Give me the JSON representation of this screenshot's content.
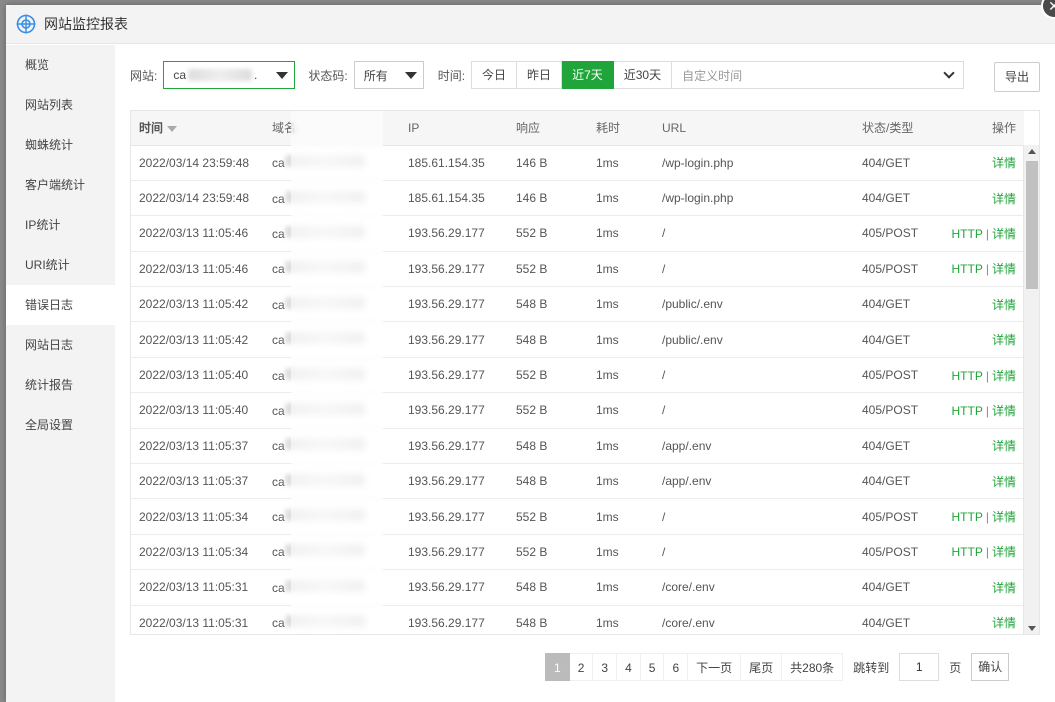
{
  "window": {
    "title": "网站监控报表",
    "close": "✕"
  },
  "sidebar": {
    "items": [
      {
        "label": "概览"
      },
      {
        "label": "网站列表"
      },
      {
        "label": "蜘蛛统计"
      },
      {
        "label": "客户端统计"
      },
      {
        "label": "IP统计"
      },
      {
        "label": "URI统计"
      },
      {
        "label": "错误日志"
      },
      {
        "label": "网站日志"
      },
      {
        "label": "统计报告"
      },
      {
        "label": "全局设置"
      }
    ],
    "active_index": 6
  },
  "filters": {
    "site_label": "网站:",
    "site_value": "ca",
    "site_suffix": ".",
    "status_label": "状态码:",
    "status_value": "所有",
    "time_label": "时间:",
    "ranges": [
      "今日",
      "昨日",
      "近7天",
      "近30天"
    ],
    "active_range": "近7天",
    "custom_placeholder": "自定义时间",
    "export_label": "导出"
  },
  "table": {
    "columns": [
      "时间",
      "域名",
      "IP",
      "响应",
      "耗时",
      "URL",
      "状态/类型",
      "操作"
    ],
    "domain_prefix": "ca",
    "http_label": "HTTP",
    "detail_label": "详情",
    "rows": [
      {
        "time": "2022/03/14 23:59:48",
        "ip": "185.61.154.35",
        "resp": "146 B",
        "cost": "1ms",
        "url": "/wp-login.php",
        "status": "404/GET",
        "http": false
      },
      {
        "time": "2022/03/14 23:59:48",
        "ip": "185.61.154.35",
        "resp": "146 B",
        "cost": "1ms",
        "url": "/wp-login.php",
        "status": "404/GET",
        "http": false
      },
      {
        "time": "2022/03/13 11:05:46",
        "ip": "193.56.29.177",
        "resp": "552 B",
        "cost": "1ms",
        "url": "/",
        "status": "405/POST",
        "http": true
      },
      {
        "time": "2022/03/13 11:05:46",
        "ip": "193.56.29.177",
        "resp": "552 B",
        "cost": "1ms",
        "url": "/",
        "status": "405/POST",
        "http": true
      },
      {
        "time": "2022/03/13 11:05:42",
        "ip": "193.56.29.177",
        "resp": "548 B",
        "cost": "1ms",
        "url": "/public/.env",
        "status": "404/GET",
        "http": false
      },
      {
        "time": "2022/03/13 11:05:42",
        "ip": "193.56.29.177",
        "resp": "548 B",
        "cost": "1ms",
        "url": "/public/.env",
        "status": "404/GET",
        "http": false
      },
      {
        "time": "2022/03/13 11:05:40",
        "ip": "193.56.29.177",
        "resp": "552 B",
        "cost": "1ms",
        "url": "/",
        "status": "405/POST",
        "http": true
      },
      {
        "time": "2022/03/13 11:05:40",
        "ip": "193.56.29.177",
        "resp": "552 B",
        "cost": "1ms",
        "url": "/",
        "status": "405/POST",
        "http": true
      },
      {
        "time": "2022/03/13 11:05:37",
        "ip": "193.56.29.177",
        "resp": "548 B",
        "cost": "1ms",
        "url": "/app/.env",
        "status": "404/GET",
        "http": false
      },
      {
        "time": "2022/03/13 11:05:37",
        "ip": "193.56.29.177",
        "resp": "548 B",
        "cost": "1ms",
        "url": "/app/.env",
        "status": "404/GET",
        "http": false
      },
      {
        "time": "2022/03/13 11:05:34",
        "ip": "193.56.29.177",
        "resp": "552 B",
        "cost": "1ms",
        "url": "/",
        "status": "405/POST",
        "http": true
      },
      {
        "time": "2022/03/13 11:05:34",
        "ip": "193.56.29.177",
        "resp": "552 B",
        "cost": "1ms",
        "url": "/",
        "status": "405/POST",
        "http": true
      },
      {
        "time": "2022/03/13 11:05:31",
        "ip": "193.56.29.177",
        "resp": "548 B",
        "cost": "1ms",
        "url": "/core/.env",
        "status": "404/GET",
        "http": false
      },
      {
        "time": "2022/03/13 11:05:31",
        "ip": "193.56.29.177",
        "resp": "548 B",
        "cost": "1ms",
        "url": "/core/.env",
        "status": "404/GET",
        "http": false
      }
    ]
  },
  "pagination": {
    "pages": [
      "1",
      "2",
      "3",
      "4",
      "5",
      "6"
    ],
    "current": "1",
    "next": "下一页",
    "last": "尾页",
    "total": "共280条",
    "jump_label": "跳转到",
    "jump_value": "1",
    "jump_unit": "页",
    "confirm": "确认"
  },
  "colors": {
    "accent": "#20a53a",
    "sidebar_bg": "#f3f3f3"
  }
}
